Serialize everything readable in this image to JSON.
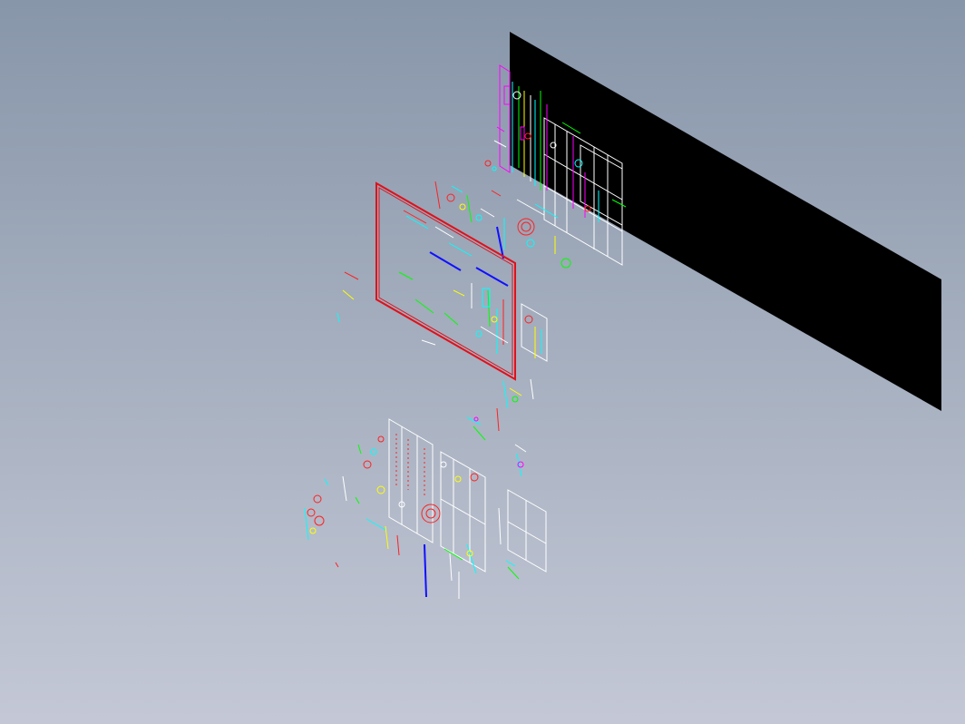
{
  "viewport": {
    "background_top": "#8896aa",
    "background_bottom": "#c4c8d6"
  },
  "cad_colors": {
    "sheet_fill": "#000000",
    "frame_red": "#e0101a",
    "line_white": "#ffffff",
    "line_cyan": "#00ffff",
    "line_green": "#00ff00",
    "line_magenta": "#ff00ff",
    "line_yellow": "#ffff00",
    "line_blue": "#1010ff",
    "line_red": "#ff2020"
  }
}
